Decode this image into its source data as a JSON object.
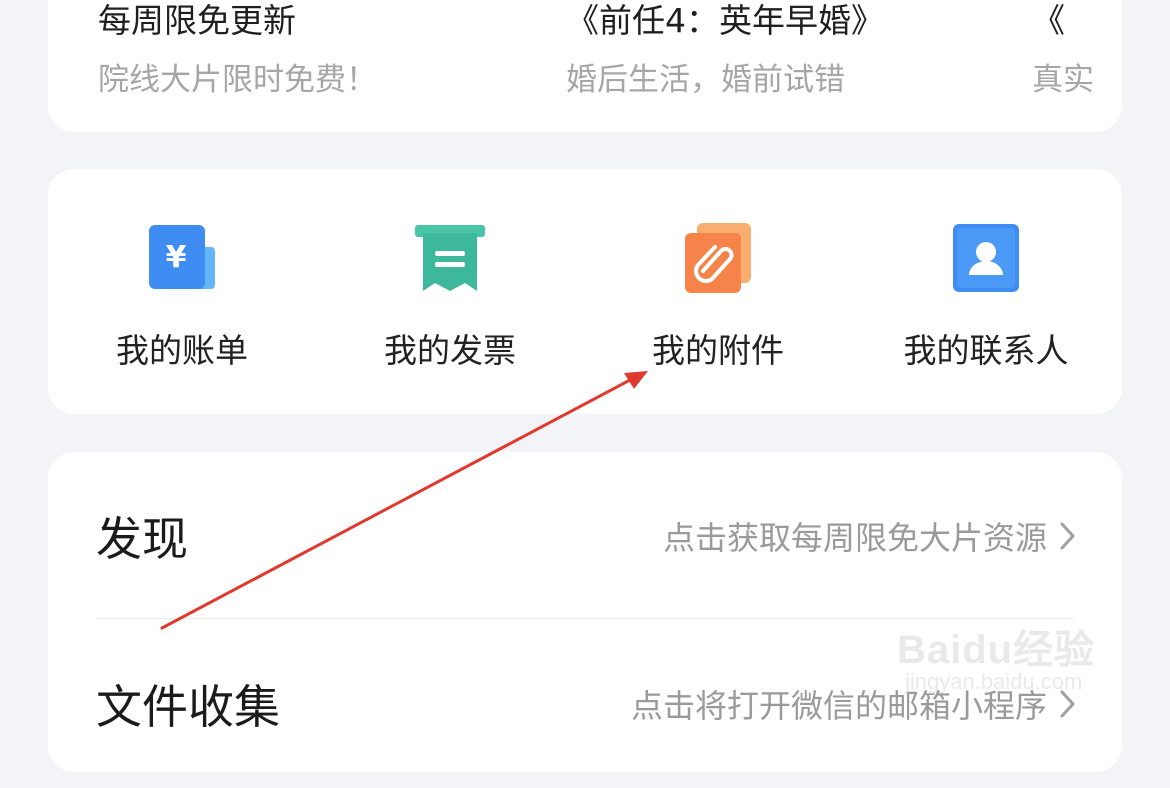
{
  "promo": {
    "items": [
      {
        "title": "每周限免更新",
        "subtitle": "院线大片限时免费！"
      },
      {
        "title": "《前任4：英年早婚》",
        "subtitle": "婚后生活，婚前试错"
      },
      {
        "title": "《",
        "subtitle": "真实"
      }
    ]
  },
  "shortcuts": {
    "items": [
      {
        "label": "我的账单",
        "icon": "bill-icon",
        "color": "#3f8cf2"
      },
      {
        "label": "我的发票",
        "icon": "invoice-icon",
        "color": "#49c5a8"
      },
      {
        "label": "我的附件",
        "icon": "attachment-icon",
        "color": "#f5834a"
      },
      {
        "label": "我的联系人",
        "icon": "contacts-icon",
        "color": "#3f8cf2"
      }
    ],
    "bill_symbol": "¥"
  },
  "list": {
    "discover": {
      "title": "发现",
      "hint": "点击获取每周限免大片资源"
    },
    "file_collect": {
      "title": "文件收集",
      "hint": "点击将打开微信的邮箱小程序"
    }
  },
  "annotation": {
    "color": "#e03a2f"
  },
  "watermark": {
    "text": "Baidu经验",
    "sub": "jingyan.baidu.com"
  }
}
